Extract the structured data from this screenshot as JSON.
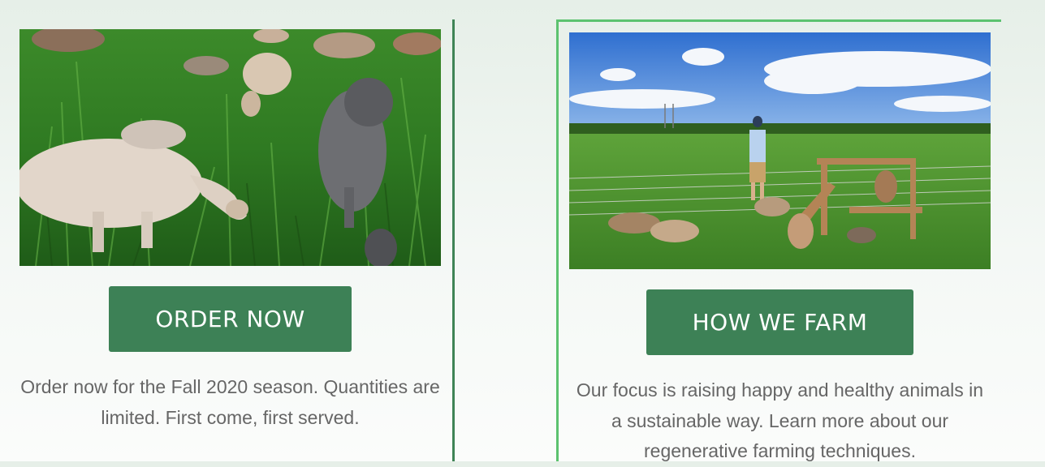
{
  "order_card": {
    "button_label": "ORDER NOW",
    "description": "Order now for the Fall 2020 season. Quantities are limited. First come, first served."
  },
  "farm_card": {
    "button_label": "HOW WE FARM",
    "description": "Our focus is raising happy and healthy animals in a sustainable way. Learn more about our regenerative farming techniques."
  },
  "colors": {
    "button": "#3d8156",
    "divider": "#3f8456",
    "accent_border": "#5cc26f",
    "text": "#666666"
  }
}
